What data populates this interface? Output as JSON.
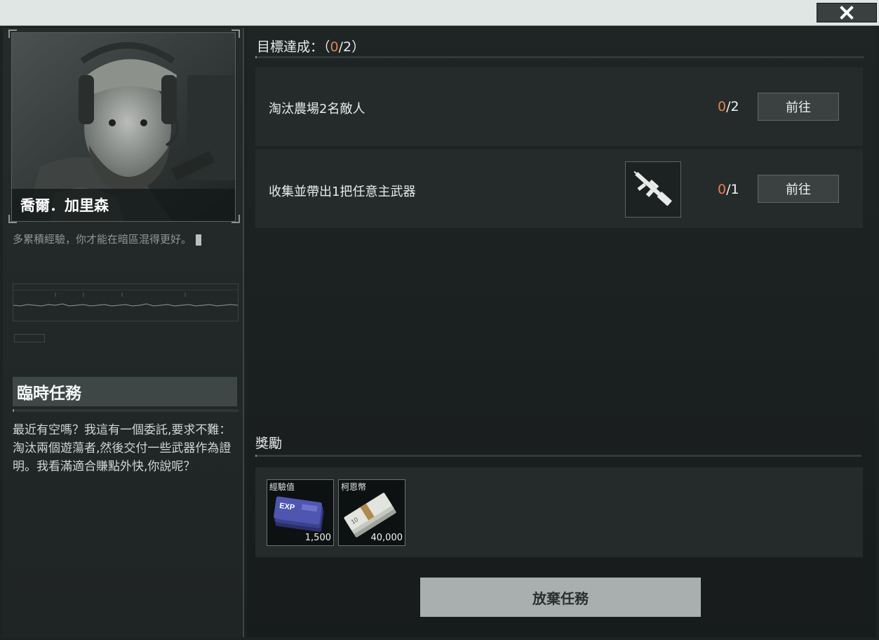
{
  "window": {
    "close_icon": "close-x-icon"
  },
  "npc": {
    "name": "喬爾．加里森",
    "quote": "多累積經驗，你才能在暗區混得更好。"
  },
  "mission": {
    "title": "臨時任務",
    "description": "最近有空嗎？我這有一個委託,要求不難：淘汰兩個遊蕩者,然後交付一些武器作為證明。我看滿適合賺點外快,你說呢？"
  },
  "objectives": {
    "header_label": "目標達成：",
    "progress_current": "0",
    "progress_total": "/2",
    "open_paren": "（",
    "close_paren": "）",
    "items": [
      {
        "text": "淘汰農場2名敵人",
        "current": "0",
        "total": "/2",
        "button": "前往"
      },
      {
        "text": "收集並帶出1把任意主武器",
        "current": "0",
        "total": "/1",
        "button": "前往",
        "icon": "rifle-icon"
      }
    ]
  },
  "rewards": {
    "header": "獎勵",
    "items": [
      {
        "label": "經驗值",
        "value": "1,500",
        "icon": "exp-ticket-icon"
      },
      {
        "label": "柯恩幣",
        "value": "40,000",
        "icon": "cash-stack-icon"
      }
    ]
  },
  "abandon_button": "放棄任務",
  "colors": {
    "accent": "#e87f4f",
    "panel": "#252b2b",
    "button": "#3b4141"
  }
}
